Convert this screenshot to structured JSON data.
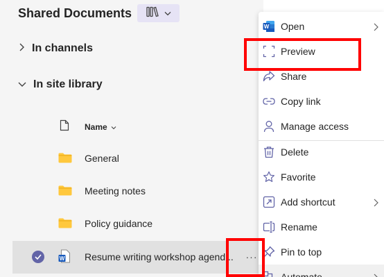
{
  "header": {
    "title": "Shared Documents"
  },
  "sections": [
    {
      "label": "In channels"
    },
    {
      "label": "In site library"
    }
  ],
  "columns": {
    "name": "Name"
  },
  "files": [
    {
      "name": "General"
    },
    {
      "name": "Meeting notes"
    },
    {
      "name": "Policy guidance"
    },
    {
      "name": "Resume writing workshop agend..."
    }
  ],
  "row_actions": {
    "more": "···"
  },
  "menu": {
    "items": [
      {
        "label": "Open",
        "icon": "word-icon"
      },
      {
        "label": "Preview",
        "icon": "preview-icon"
      },
      {
        "label": "Share",
        "icon": "share-icon"
      },
      {
        "label": "Copy link",
        "icon": "link-icon"
      },
      {
        "label": "Manage access",
        "icon": "person-icon"
      },
      {
        "label": "Delete",
        "icon": "trash-icon"
      },
      {
        "label": "Favorite",
        "icon": "star-icon"
      },
      {
        "label": "Add shortcut",
        "icon": "shortcut-icon"
      },
      {
        "label": "Rename",
        "icon": "rename-icon"
      },
      {
        "label": "Pin to top",
        "icon": "pin-icon"
      },
      {
        "label": "Automate",
        "icon": "automate-icon"
      }
    ]
  },
  "colors": {
    "accent": "#6264a7",
    "folder": "#ffc83d",
    "word_blue": "#185abd",
    "highlight_red": "#ff0000"
  }
}
